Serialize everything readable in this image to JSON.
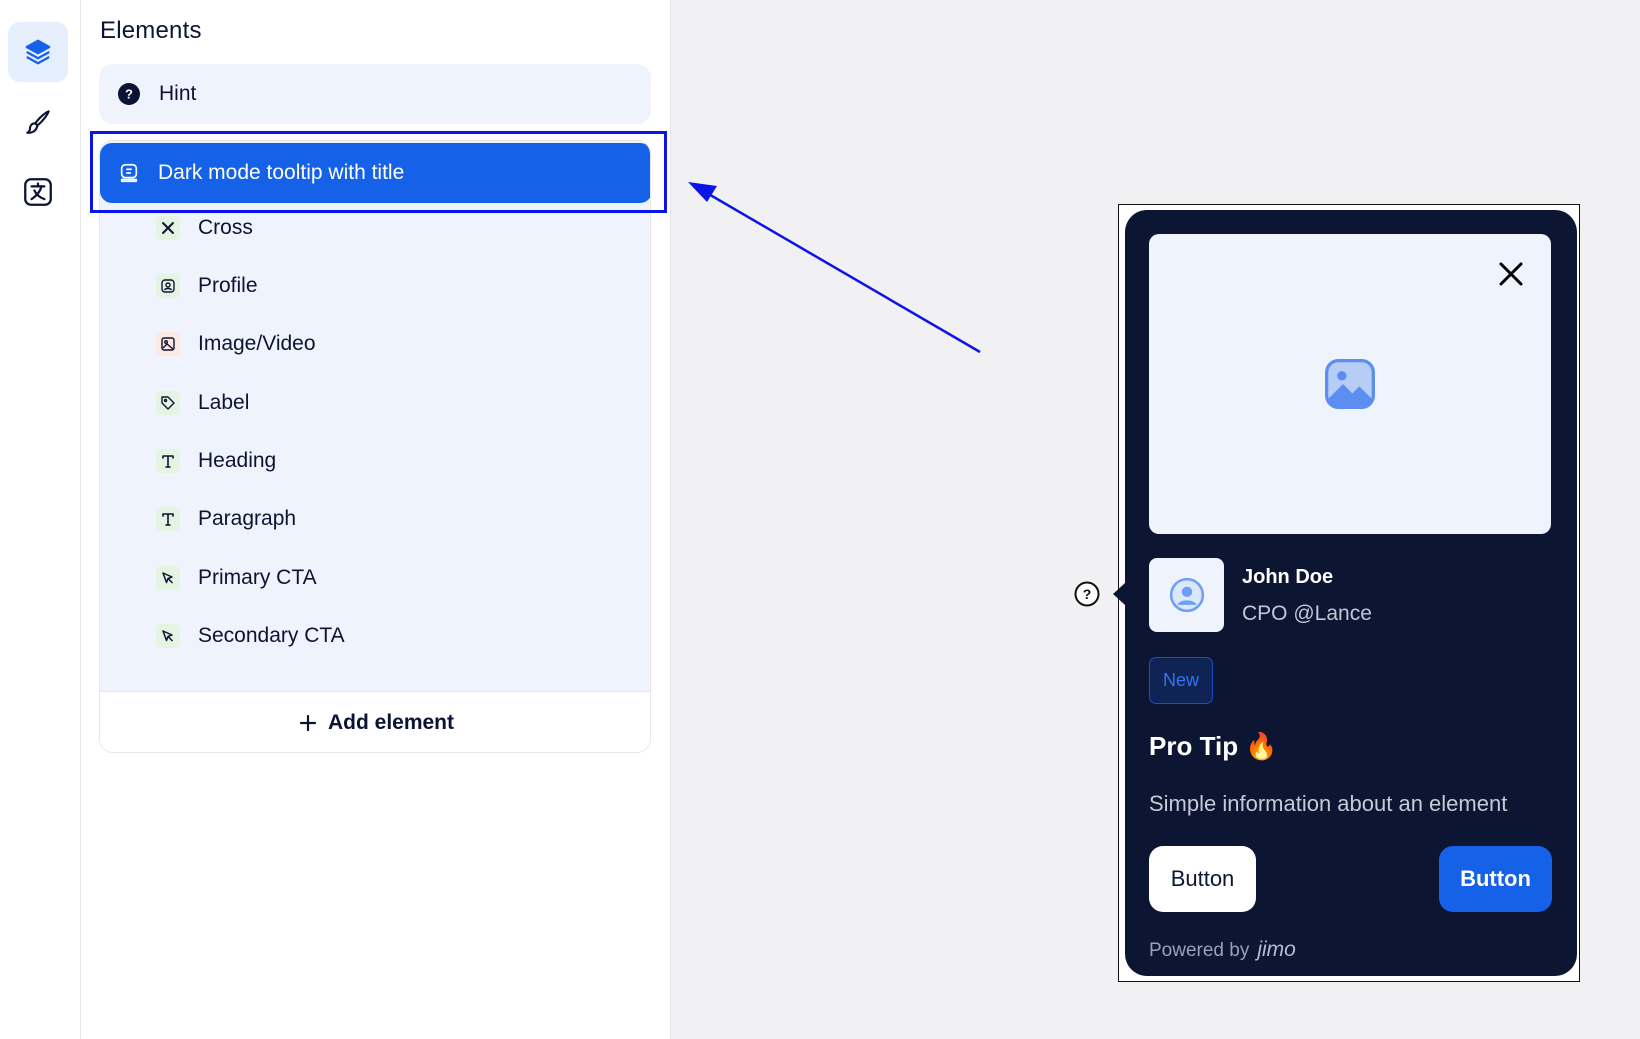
{
  "rail": {
    "items": [
      {
        "icon": "layers-icon",
        "active": true
      },
      {
        "icon": "brush-icon",
        "active": false
      },
      {
        "icon": "translate-icon",
        "active": false
      }
    ]
  },
  "panel": {
    "title": "Elements",
    "hint_label": "Hint",
    "selected_label": "Dark mode tooltip with title",
    "children": [
      {
        "label": "Cross",
        "icon": "cross-icon"
      },
      {
        "label": "Profile",
        "icon": "profile-icon"
      },
      {
        "label": "Image/Video",
        "icon": "image-icon"
      },
      {
        "label": "Label",
        "icon": "tag-icon"
      },
      {
        "label": "Heading",
        "icon": "text-icon"
      },
      {
        "label": "Paragraph",
        "icon": "text-icon"
      },
      {
        "label": "Primary CTA",
        "icon": "cursor-icon"
      },
      {
        "label": "Secondary CTA",
        "icon": "cursor-icon"
      }
    ],
    "add_label": "Add element"
  },
  "tooltip": {
    "profile_name": "John Doe",
    "profile_role": "CPO @Lance",
    "badge": "New",
    "heading": "Pro Tip 🔥",
    "paragraph": "Simple information about an element",
    "secondary_button": "Button",
    "primary_button": "Button",
    "powered_by": "Powered by",
    "brand": "jimo"
  },
  "colors": {
    "accent": "#1562e9",
    "tooltip_bg": "#0c1633",
    "panel_row_bg": "#eef3fc",
    "highlight_outline": "#0d14e6"
  }
}
